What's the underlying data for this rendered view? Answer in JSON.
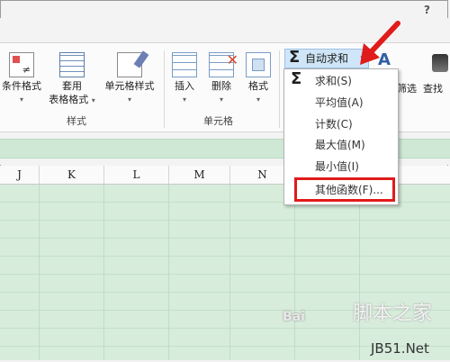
{
  "help_label": "?",
  "ribbon": {
    "styles_group": {
      "label": "样式",
      "buttons": [
        {
          "label": "条件格式",
          "icon": "conditional-format-icon"
        },
        {
          "label1": "套用",
          "label2": "表格格式",
          "icon": "table-format-icon"
        },
        {
          "label": "单元格样式",
          "icon": "cell-style-icon"
        }
      ]
    },
    "cells_group": {
      "label": "单元格",
      "buttons": [
        {
          "label": "插入",
          "icon": "insert-icon"
        },
        {
          "label": "删除",
          "icon": "delete-icon"
        },
        {
          "label": "格式",
          "icon": "format-icon"
        }
      ]
    },
    "editing": {
      "autosum_label": "自动求和",
      "filter_label": "筛选",
      "find_label": "查找"
    }
  },
  "columns": [
    "J",
    "K",
    "L",
    "M",
    "N"
  ],
  "menu": {
    "items": [
      {
        "label": "求和(S)",
        "has_icon": true
      },
      {
        "label": "平均值(A)"
      },
      {
        "label": "计数(C)"
      },
      {
        "label": "最大值(M)"
      },
      {
        "label": "最小值(I)"
      },
      {
        "label": "其他函数(F)...",
        "highlighted": true
      }
    ]
  },
  "watermark": {
    "baidu": "Bai",
    "line1": "脚本之家",
    "line2": "JB51.Net"
  },
  "colors": {
    "accent_red": "#e01b1b",
    "sheet_green": "#d7ecdb",
    "autosum_bg": "#cfe6f8"
  }
}
